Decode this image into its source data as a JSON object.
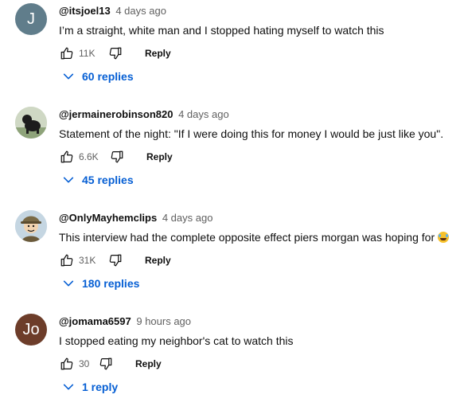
{
  "comments": [
    {
      "avatar_letter": "J",
      "avatar_color": "#607d8b",
      "handle": "@itsjoel13",
      "time": "4 days ago",
      "text": "I’m a straight, white man and I stopped hating myself to watch this",
      "likes": "11K",
      "reply_label": "Reply",
      "replies_label": "60 replies"
    },
    {
      "avatar_letter": "",
      "avatar_color": "#b9c7a8",
      "handle": "@jermainerobinson820",
      "time": "4 days ago",
      "text": "Statement of the  night: \"If I were doing this for money I would be just like you\".",
      "likes": "6.6K",
      "reply_label": "Reply",
      "replies_label": "45 replies"
    },
    {
      "avatar_letter": "",
      "avatar_color": "#c8d8e4",
      "handle": "@OnlyMayhemclips",
      "time": "4 days ago",
      "text": "This interview had the complete opposite effect piers morgan was hoping for",
      "emoji": "rolling-on-floor-laughing-emoji",
      "likes": "31K",
      "reply_label": "Reply",
      "replies_label": "180 replies"
    },
    {
      "avatar_letter": "Jo",
      "avatar_color": "#6d3d2a",
      "handle": "@jomama6597",
      "time": "9 hours ago",
      "text": "I stopped eating my neighbor's cat to watch this",
      "likes": "30",
      "reply_label": "Reply",
      "replies_label": "1 reply"
    }
  ],
  "colors": {
    "link_blue": "#065fd4",
    "secondary_text": "#606060",
    "primary_text": "#0f0f0f"
  },
  "icons": {
    "like": "thumbs-up-icon",
    "dislike": "thumbs-down-icon",
    "expand": "chevron-down-icon"
  }
}
